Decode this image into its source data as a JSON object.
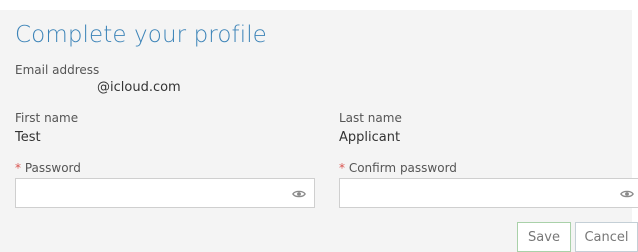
{
  "form": {
    "title": "Complete your profile",
    "email": {
      "label": "Email address",
      "value": "@icloud.com"
    },
    "first_name": {
      "label": "First name",
      "value": "Test"
    },
    "last_name": {
      "label": "Last name",
      "value": "Applicant"
    },
    "password": {
      "required_marker": "*",
      "label": "Password",
      "value": "",
      "icon": "eye-icon"
    },
    "confirm_password": {
      "required_marker": "*",
      "label": "Confirm password",
      "value": "",
      "icon": "eye-icon"
    },
    "actions": {
      "save_label": "Save",
      "cancel_label": "Cancel"
    }
  },
  "colors": {
    "title": "#3d84b8",
    "required": "#d9534f",
    "panel_background": "#f4f4f4"
  }
}
